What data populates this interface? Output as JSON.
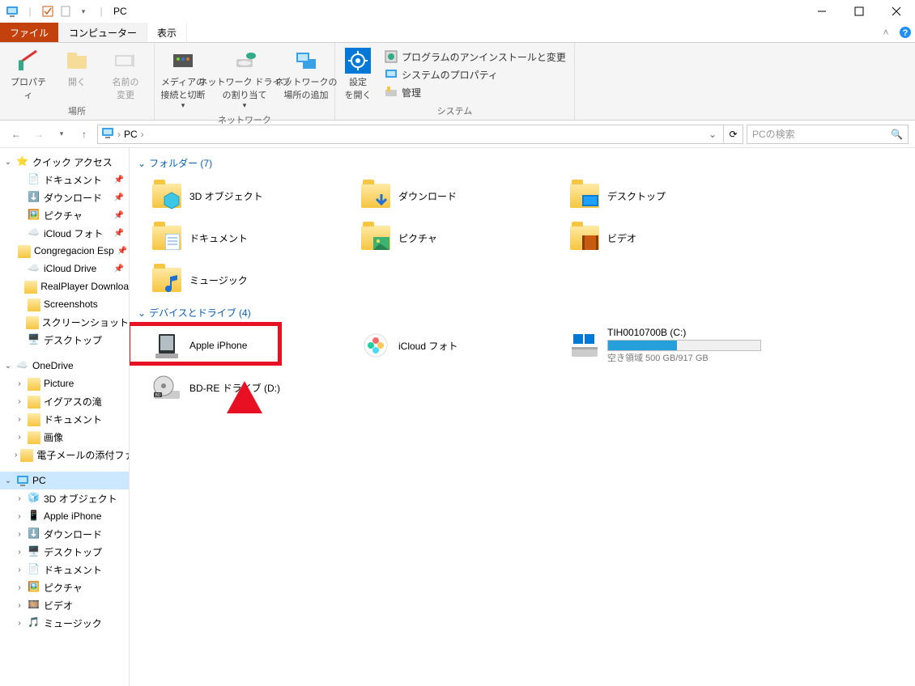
{
  "title": "PC",
  "tabs": {
    "file": "ファイル",
    "computer": "コンピューター",
    "view": "表示"
  },
  "ribbon": {
    "group_location": "場所",
    "group_network": "ネットワーク",
    "group_system": "システム",
    "properties": "プロパティ",
    "open": "開く",
    "rename": "名前の\n変更",
    "media": "メディアの\n接続と切断",
    "netmap": "ネットワーク ドライブ\nの割り当て",
    "addloc": "ネットワークの\n場所の追加",
    "settings": "設定\nを開く",
    "uninstall": "プログラムのアンインストールと変更",
    "sysprops": "システムのプロパティ",
    "manage": "管理"
  },
  "path": {
    "root": "PC"
  },
  "search_placeholder": "PCの検索",
  "sidebar": {
    "quick": "クイック アクセス",
    "qitems": [
      "ドキュメント",
      "ダウンロード",
      "ピクチャ",
      "iCloud フォト",
      "Congregacion Esp",
      "iCloud Drive",
      "RealPlayer Downloa",
      "Screenshots",
      "スクリーンショット",
      "デスクトップ"
    ],
    "onedrive": "OneDrive",
    "oditems": [
      "Picture",
      "イグアスの滝",
      "ドキュメント",
      "画像",
      "電子メールの添付ファイ"
    ],
    "pc": "PC",
    "pcitems": [
      "3D オブジェクト",
      "Apple iPhone",
      "ダウンロード",
      "デスクトップ",
      "ドキュメント",
      "ピクチャ",
      "ビデオ",
      "ミュージック"
    ]
  },
  "sections": {
    "folders": "フォルダー (7)",
    "devices": "デバイスとドライブ (4)"
  },
  "folders": [
    {
      "label": "3D オブジェクト"
    },
    {
      "label": "ダウンロード"
    },
    {
      "label": "デスクトップ"
    },
    {
      "label": "ドキュメント"
    },
    {
      "label": "ピクチャ"
    },
    {
      "label": "ビデオ"
    },
    {
      "label": "ミュージック"
    }
  ],
  "devices": {
    "iphone": "Apple iPhone",
    "icloud": "iCloud フォト",
    "cdrive": "TIH0010700B (C:)",
    "cdrive_sub": "空き領域 500 GB/917 GB",
    "cdrive_pct": 45,
    "bdre": "BD-RE ドライブ (D:)"
  }
}
